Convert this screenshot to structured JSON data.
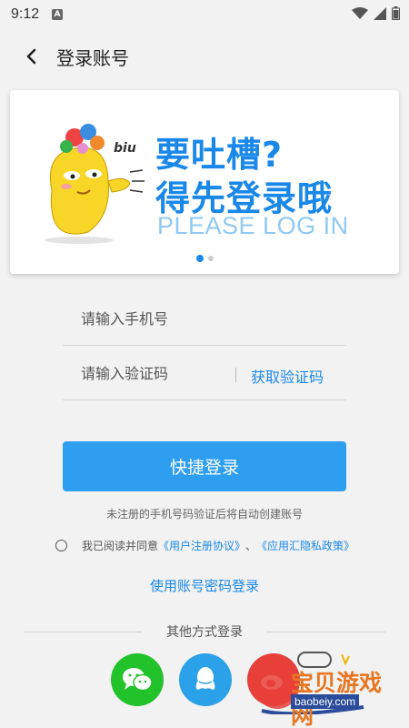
{
  "status_bar": {
    "time": "9:12",
    "notification_icon": "A"
  },
  "header": {
    "title": "登录账号",
    "back_icon": "back-arrow-icon"
  },
  "banner": {
    "line1": "要吐槽?",
    "line2": "得先登录哦",
    "english": "PLEASE LOG IN",
    "mascot_text": "biu",
    "dots_total": 2,
    "dots_active": 1
  },
  "form": {
    "phone_placeholder": "请输入手机号",
    "code_placeholder": "请输入验证码",
    "get_code_label": "获取验证码",
    "login_button": "快捷登录",
    "hint": "未注册的手机号码验证后将自动创建账号",
    "agree_prefix": "我已阅读并同意",
    "agreement_link": "《用户注册协议》",
    "agree_separator": "、",
    "privacy_link": "《应用汇隐私政策》",
    "account_login": "使用账号密码登录"
  },
  "other_login": {
    "label": "其他方式登录",
    "methods": [
      "wechat-icon",
      "qq-icon",
      "weibo-icon"
    ]
  },
  "watermark": {
    "text": "宝贝游戏网",
    "url": "baobeiy.com"
  },
  "colors": {
    "accent": "#1a88e8",
    "button": "#2e9ef0",
    "wechat": "#22c22b",
    "qq": "#2aa1e8",
    "weibo": "#e7403a"
  }
}
